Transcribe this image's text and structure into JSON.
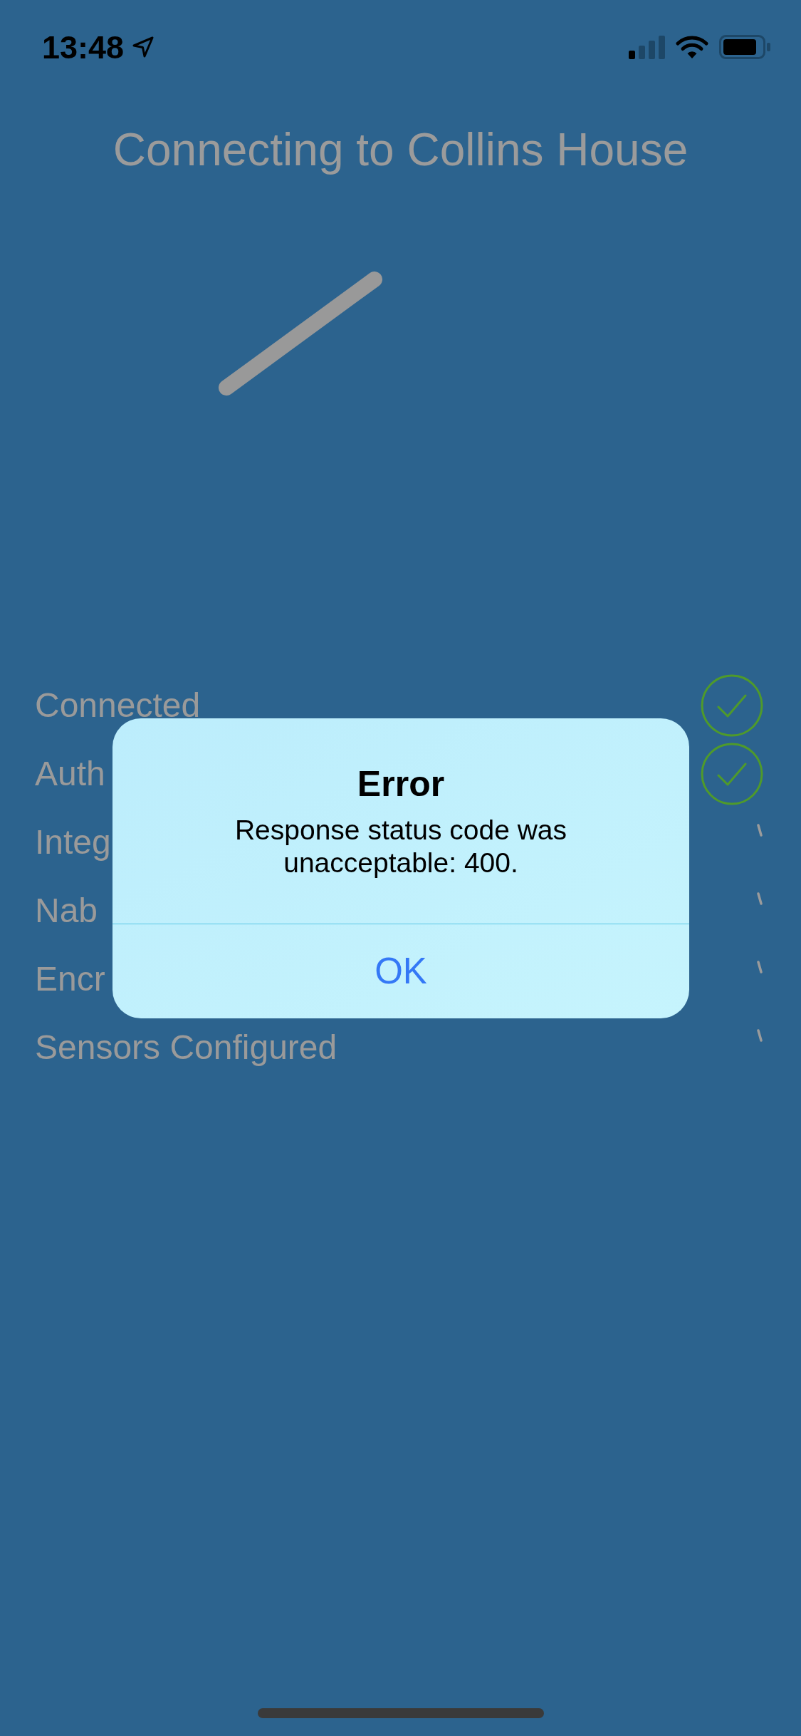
{
  "status_bar": {
    "time": "13:48"
  },
  "title": "Connecting to Collins House",
  "steps": [
    {
      "label": "Connected",
      "done": true
    },
    {
      "label": "Auth",
      "done": true
    },
    {
      "label": "Integ",
      "done": false
    },
    {
      "label": "Nab",
      "done": false
    },
    {
      "label": "Encr",
      "done": false
    },
    {
      "label": "Sensors Configured",
      "done": false
    }
  ],
  "alert": {
    "title": "Error",
    "message": "Response status code was unacceptable: 400.",
    "buttons": [
      {
        "label": "OK"
      }
    ]
  }
}
